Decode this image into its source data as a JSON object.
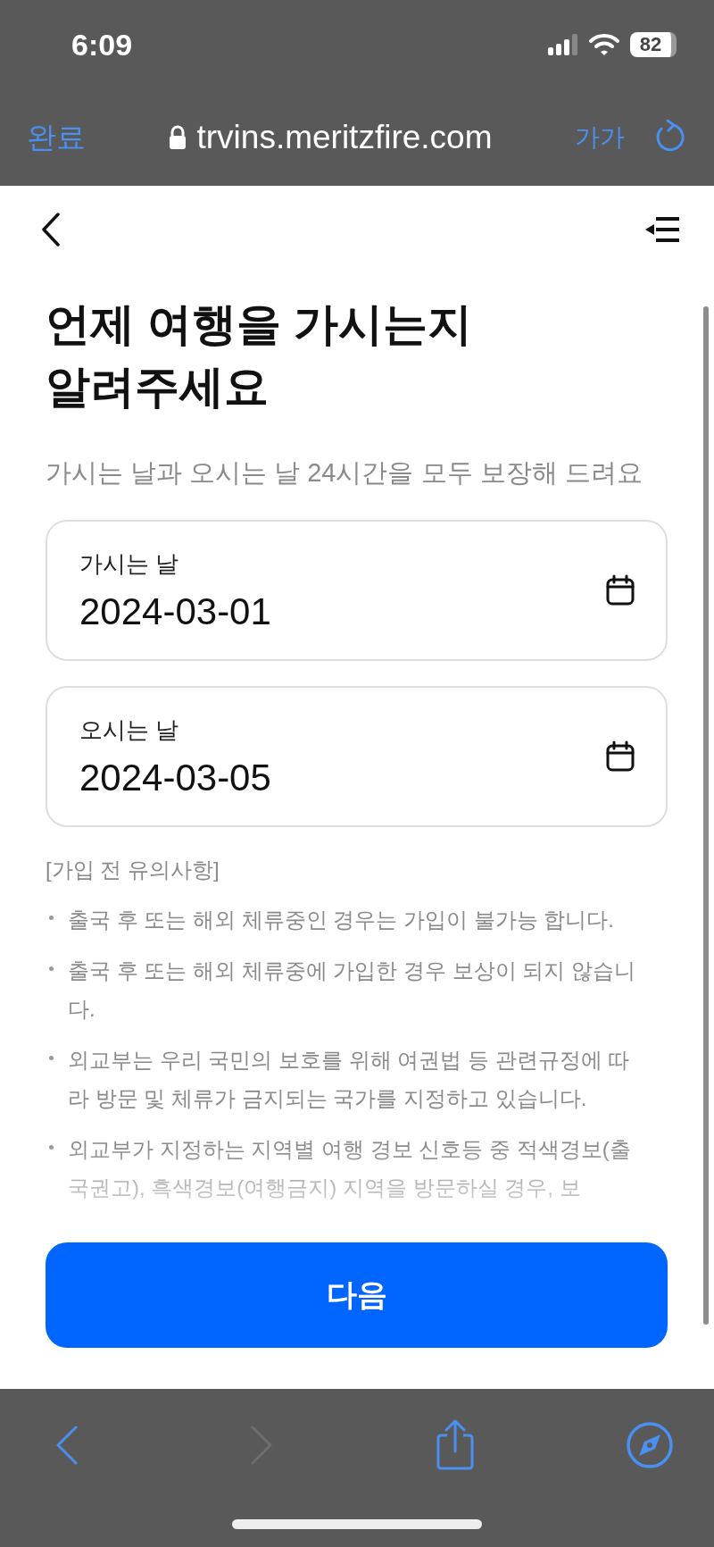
{
  "status_bar": {
    "time": "6:09",
    "battery": "82"
  },
  "browser_bar": {
    "done": "완료",
    "url": "trvins.meritzfire.com",
    "text_size": "가가"
  },
  "page": {
    "title": "언제 여행을 가시는지\n알려주세요",
    "subtitle": "가시는 날과 오시는 날 24시간을 모두 보장해 드려요",
    "date_fields": [
      {
        "label": "가시는 날",
        "value": "2024-03-01"
      },
      {
        "label": "오시는 날",
        "value": "2024-03-05"
      }
    ],
    "notes_title": "[가입 전 유의사항]",
    "notes": [
      "출국 후 또는 해외 체류중인 경우는 가입이 불가능 합니다.",
      "출국 후 또는 해외 체류중에 가입한 경우 보상이 되지 않습니다.",
      "외교부는 우리 국민의 보호를 위해 여권법 등 관련규정에 따라 방문 및 체류가 금지되는 국가를 지정하고 있습니다.",
      "외교부가 지정하는 지역별 여행 경보 신호등 중 적색경보(출국권고), 흑색경보(여행금지) 지역을 방문하실 경우, 보"
    ],
    "next_button": "다음"
  },
  "toolbar": [
    {
      "kind": "back",
      "disabled": false
    },
    {
      "kind": "forward",
      "disabled": true
    },
    {
      "kind": "share",
      "disabled": false
    },
    {
      "kind": "compass",
      "disabled": false
    }
  ]
}
